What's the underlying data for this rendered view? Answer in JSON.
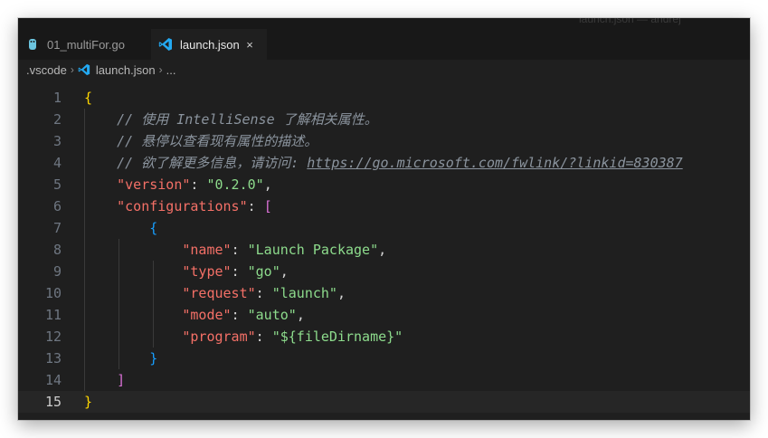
{
  "ghost_title": "launch.json — andrej",
  "tabs": [
    {
      "label": "01_multiFor.go",
      "icon": "go-file-icon",
      "active": false
    },
    {
      "label": "launch.json",
      "icon": "vscode-icon",
      "active": true,
      "close": "×"
    }
  ],
  "breadcrumb": {
    "folder": ".vscode",
    "file": "launch.json",
    "more": "..."
  },
  "colors": {
    "brace_level1": "#ffd700",
    "brace_level2": "#da70d6",
    "brace_level3": "#179fff",
    "json_key": "#f47067",
    "json_string": "#8ddb8c",
    "comment": "#8b949e",
    "vscode_blue": "#23a9f2",
    "go_file": "#00add8"
  },
  "editor": {
    "current_line": 15,
    "lines": [
      {
        "n": "1",
        "tokens": [
          {
            "t": "{",
            "c": "brace1"
          }
        ]
      },
      {
        "n": "2",
        "tokens": [
          {
            "t": "    ",
            "c": "punct"
          },
          {
            "t": "// 使用 IntelliSense 了解相关属性。",
            "c": "comment"
          }
        ]
      },
      {
        "n": "3",
        "tokens": [
          {
            "t": "    ",
            "c": "punct"
          },
          {
            "t": "// 悬停以查看现有属性的描述。",
            "c": "comment"
          }
        ]
      },
      {
        "n": "4",
        "tokens": [
          {
            "t": "    ",
            "c": "punct"
          },
          {
            "t": "// 欲了解更多信息，请访问: ",
            "c": "comment"
          },
          {
            "t": "https://go.microsoft.com/fwlink/?linkid=830387",
            "c": "link"
          }
        ]
      },
      {
        "n": "5",
        "tokens": [
          {
            "t": "    ",
            "c": "punct"
          },
          {
            "t": "\"version\"",
            "c": "key"
          },
          {
            "t": ": ",
            "c": "punct"
          },
          {
            "t": "\"0.2.0\"",
            "c": "str"
          },
          {
            "t": ",",
            "c": "punct"
          }
        ]
      },
      {
        "n": "6",
        "tokens": [
          {
            "t": "    ",
            "c": "punct"
          },
          {
            "t": "\"configurations\"",
            "c": "key"
          },
          {
            "t": ": ",
            "c": "punct"
          },
          {
            "t": "[",
            "c": "brace2"
          }
        ]
      },
      {
        "n": "7",
        "tokens": [
          {
            "t": "        ",
            "c": "punct"
          },
          {
            "t": "{",
            "c": "brace3"
          }
        ]
      },
      {
        "n": "8",
        "tokens": [
          {
            "t": "            ",
            "c": "punct"
          },
          {
            "t": "\"name\"",
            "c": "key"
          },
          {
            "t": ": ",
            "c": "punct"
          },
          {
            "t": "\"Launch Package\"",
            "c": "str"
          },
          {
            "t": ",",
            "c": "punct"
          }
        ]
      },
      {
        "n": "9",
        "tokens": [
          {
            "t": "            ",
            "c": "punct"
          },
          {
            "t": "\"type\"",
            "c": "key"
          },
          {
            "t": ": ",
            "c": "punct"
          },
          {
            "t": "\"go\"",
            "c": "str"
          },
          {
            "t": ",",
            "c": "punct"
          }
        ]
      },
      {
        "n": "10",
        "tokens": [
          {
            "t": "            ",
            "c": "punct"
          },
          {
            "t": "\"request\"",
            "c": "key"
          },
          {
            "t": ": ",
            "c": "punct"
          },
          {
            "t": "\"launch\"",
            "c": "str"
          },
          {
            "t": ",",
            "c": "punct"
          }
        ]
      },
      {
        "n": "11",
        "tokens": [
          {
            "t": "            ",
            "c": "punct"
          },
          {
            "t": "\"mode\"",
            "c": "key"
          },
          {
            "t": ": ",
            "c": "punct"
          },
          {
            "t": "\"auto\"",
            "c": "str"
          },
          {
            "t": ",",
            "c": "punct"
          }
        ]
      },
      {
        "n": "12",
        "tokens": [
          {
            "t": "            ",
            "c": "punct"
          },
          {
            "t": "\"program\"",
            "c": "key"
          },
          {
            "t": ": ",
            "c": "punct"
          },
          {
            "t": "\"${fileDirname}\"",
            "c": "str"
          }
        ]
      },
      {
        "n": "13",
        "tokens": [
          {
            "t": "        ",
            "c": "punct"
          },
          {
            "t": "}",
            "c": "brace3"
          }
        ]
      },
      {
        "n": "14",
        "tokens": [
          {
            "t": "    ",
            "c": "punct"
          },
          {
            "t": "]",
            "c": "brace2"
          }
        ]
      },
      {
        "n": "15",
        "tokens": [
          {
            "t": "}",
            "c": "brace1"
          }
        ]
      }
    ]
  }
}
